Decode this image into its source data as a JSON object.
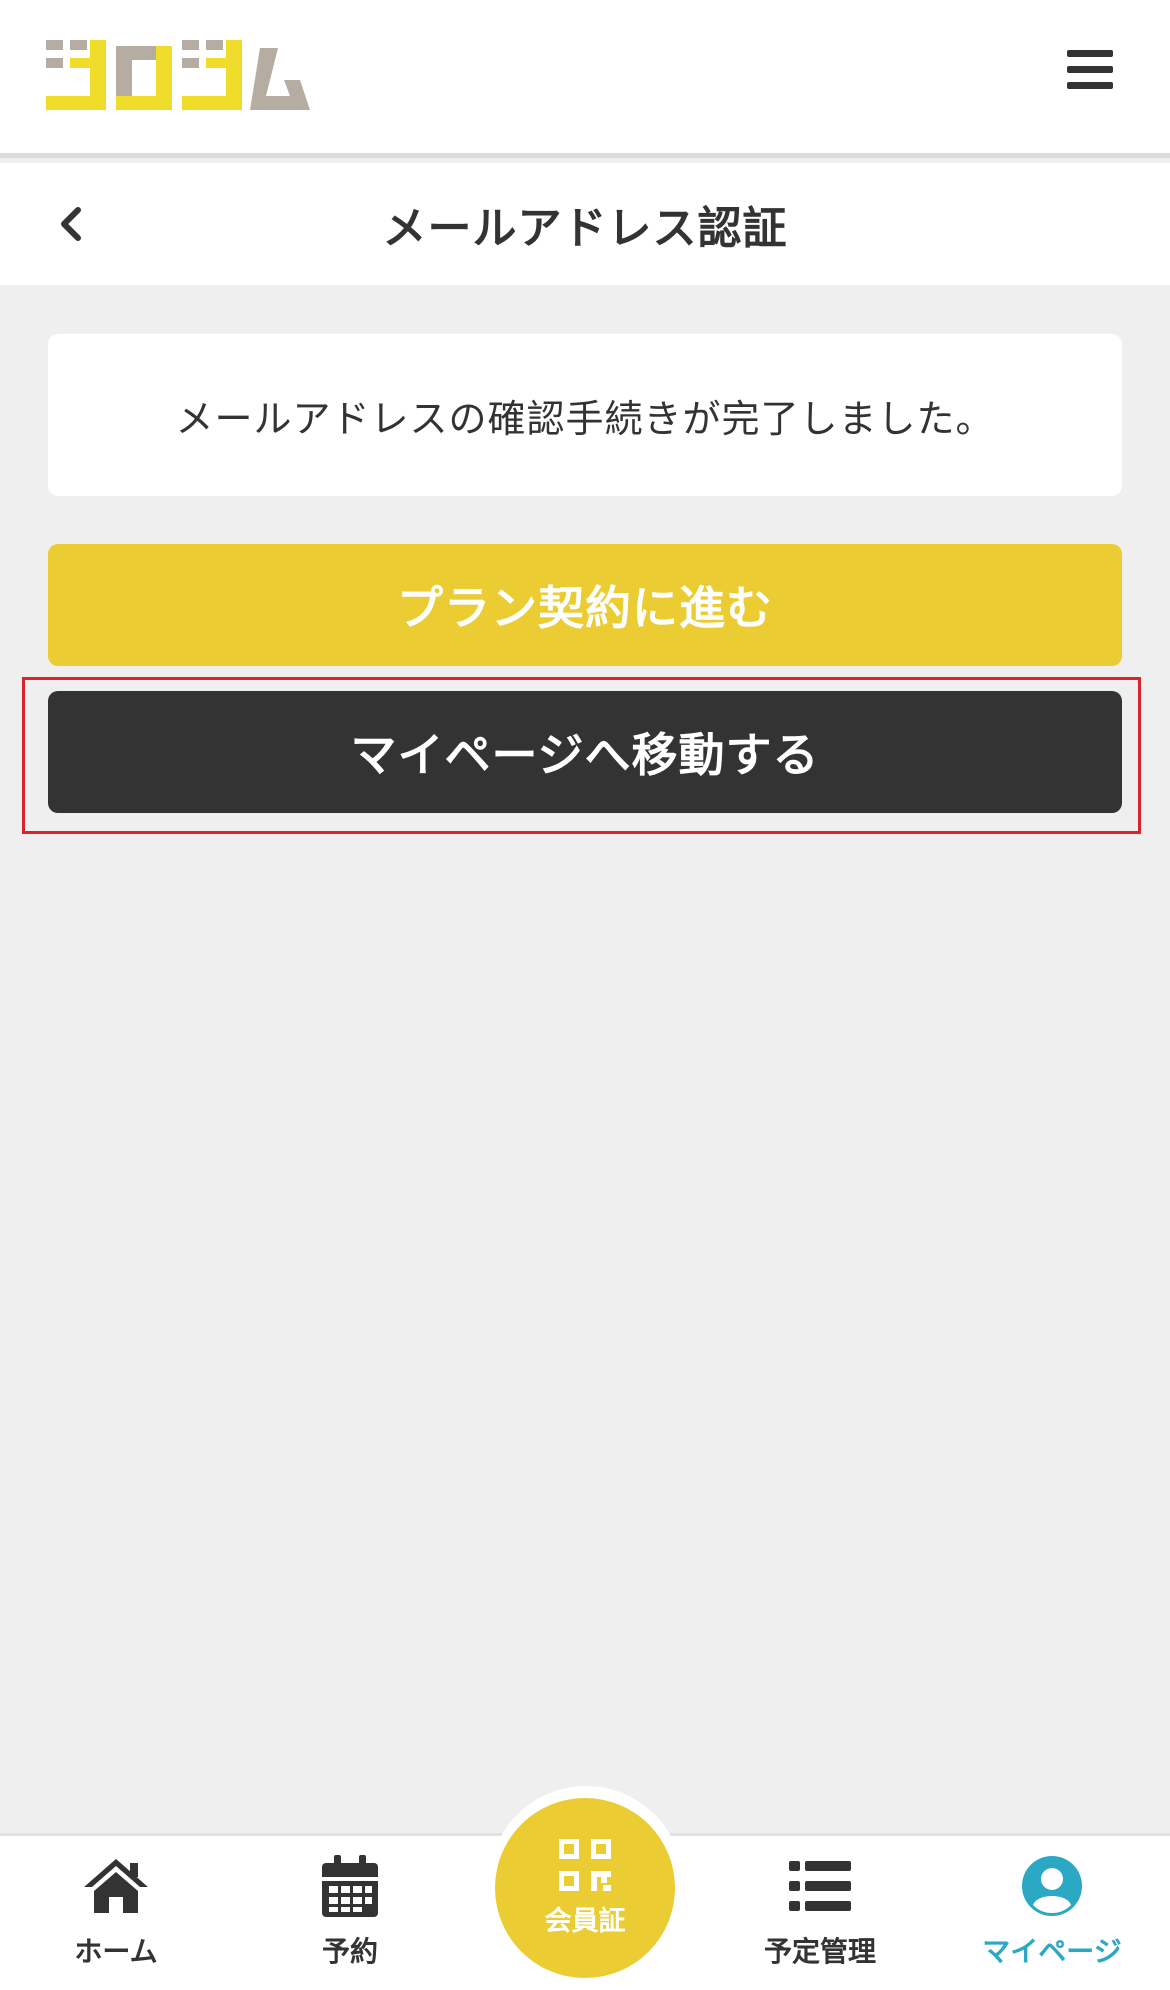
{
  "app": {
    "logo_text": "ジロジム",
    "logo_colors": {
      "yellow": "#f0dc2a",
      "gray": "#b5aca2"
    }
  },
  "subheader": {
    "title": "メールアドレス認証"
  },
  "main": {
    "message": "メールアドレスの確認手続きが完了しました。",
    "plan_button_label": "プラン契約に進む",
    "mypage_button_label": "マイページへ移動する"
  },
  "bottom_nav": {
    "items": [
      {
        "label": "ホーム",
        "icon": "home-icon"
      },
      {
        "label": "予約",
        "icon": "calendar-icon"
      },
      {
        "label": "会員証",
        "icon": "qr-code-icon"
      },
      {
        "label": "予定管理",
        "icon": "list-icon"
      },
      {
        "label": "マイページ",
        "icon": "user-icon",
        "active": true
      }
    ]
  },
  "colors": {
    "accent_yellow": "#ebcd33",
    "dark_button": "#333333",
    "active_nav": "#2aa8c4",
    "highlight_red": "#d9232d"
  }
}
